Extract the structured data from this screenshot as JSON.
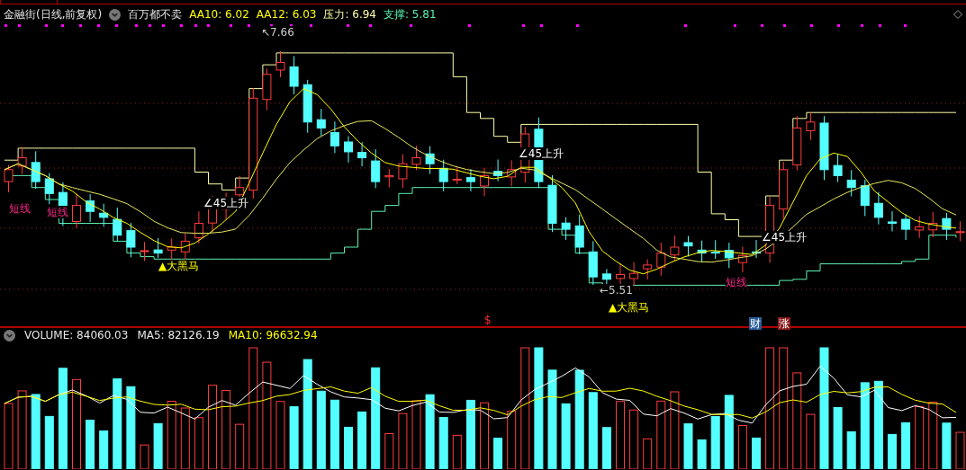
{
  "header": {
    "title": "金融街(日线,前复权)",
    "indicator": "百万都不卖",
    "values": [
      {
        "text": "AA10: 6.02",
        "color": "#ffff00"
      },
      {
        "text": "AA12: 6.03",
        "color": "#ffff00"
      },
      {
        "text": "压力: 6.94",
        "color": "#ffffa8"
      },
      {
        "text": "支撑: 5.81",
        "color": "#5cf2b0"
      }
    ]
  },
  "chart_labels": [
    {
      "kind": "price",
      "text": "↖7.66"
    },
    {
      "kind": "price",
      "text": "←5.51"
    },
    {
      "kind": "rise",
      "text": "∠45上升"
    },
    {
      "kind": "rise",
      "text": "∠45上升"
    },
    {
      "kind": "rise",
      "text": "∠45上升"
    },
    {
      "kind": "short",
      "text": "短线"
    },
    {
      "kind": "short",
      "text": "短线"
    },
    {
      "kind": "short",
      "text": "短线"
    },
    {
      "kind": "horse",
      "text": "▲大黑马"
    },
    {
      "kind": "horse",
      "text": "▲大黑马"
    },
    {
      "kind": "mark",
      "text": "$"
    },
    {
      "kind": "badge",
      "text": "财",
      "color": "#2a5c9a"
    },
    {
      "kind": "badge",
      "text": "涨",
      "color": "#8a1a1a"
    }
  ],
  "volume_header": {
    "values": [
      {
        "text": "VOLUME: 84060.03",
        "color": "#e6e6e6"
      },
      {
        "text": "MA5: 82126.19",
        "color": "#e6e6e6"
      },
      {
        "text": "MA10: 96632.94",
        "color": "#ffff00"
      }
    ]
  }
}
